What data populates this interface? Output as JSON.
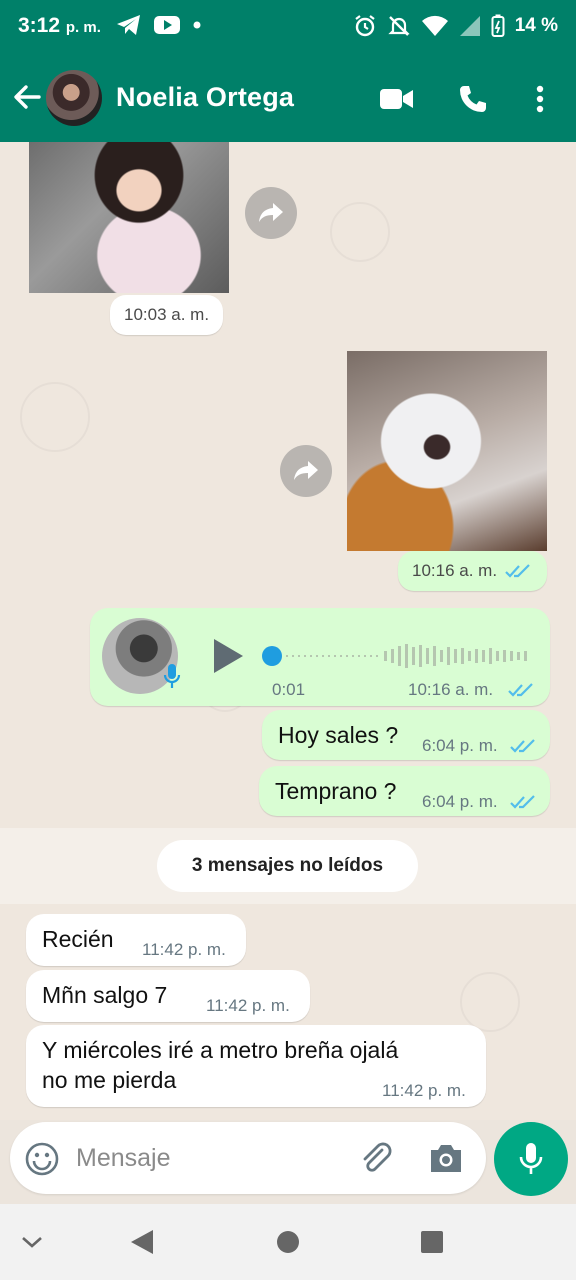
{
  "status_bar": {
    "time": "3:12",
    "time_suffix": "p. m.",
    "battery": "14 %"
  },
  "header": {
    "contact_name": "Noelia Ortega"
  },
  "messages": {
    "img1_time": "10:03 a. m.",
    "img2_time": "10:16 a. m.",
    "voice_duration": "0:01",
    "voice_time": "10:16 a. m.",
    "out1_text": "Hoy sales ?",
    "out1_time": "6:04 p. m.",
    "out2_text": "Temprano ?",
    "out2_time": "6:04 p. m.",
    "unread_label": "3 mensajes no leídos",
    "in1_text": "Recién",
    "in1_time": "11:42 p. m.",
    "in2_text": "Mñn salgo 7",
    "in2_time": "11:42 p. m.",
    "in3_line1": "Y miércoles iré a metro breña ojalá",
    "in3_line2": "no me pierda",
    "in3_time": "11:42 p. m."
  },
  "input": {
    "placeholder": "Mensaje"
  },
  "colors": {
    "header": "#008069",
    "outgoing_bubble": "#D9FDD3",
    "incoming_bubble": "#FFFFFF",
    "read_ticks": "#53BDEB",
    "mic_button": "#00A884"
  }
}
